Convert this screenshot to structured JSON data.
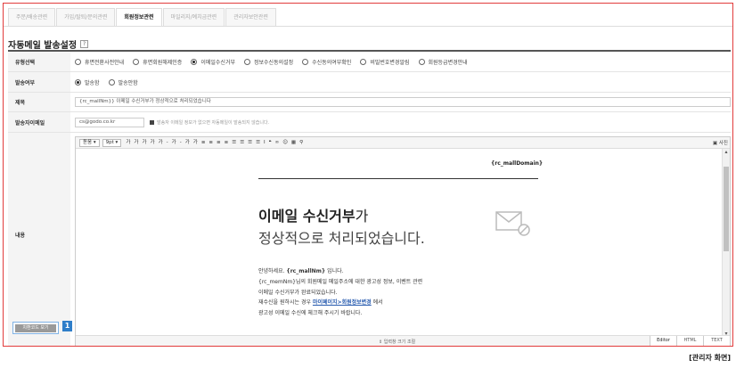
{
  "tabs": [
    "주문/배송관련",
    "가입/탈퇴/문의관련",
    "회원정보관련",
    "마일리지/예치금관련",
    "관리자보안관련"
  ],
  "active_tab": 2,
  "page_title": "자동메일 발송설정",
  "help_icon_text": "?",
  "fields": {
    "type": {
      "label": "유형선택",
      "options": [
        "휴면전환사전안내",
        "휴면회원해제인증",
        "이메일수신거부",
        "정보수신동의설정",
        "수신동의여부확인",
        "비밀번호변경알림",
        "회원등급변경안내"
      ],
      "selected": 2
    },
    "send": {
      "label": "발송여부",
      "options": [
        "발송함",
        "발송안함"
      ],
      "selected": 0
    },
    "subject": {
      "label": "제목",
      "value": "{rc_mallNm}} 이메일 수신거부가 정상적으로 처리되었습니다"
    },
    "sender": {
      "label": "발송자이메일",
      "value": "cs@godo.co.kr",
      "note": "발송자 이메일 정보가 없으면 자동메일이 발송되지 않습니다."
    },
    "content": {
      "label": "내용",
      "source_button": "치환코드 보기",
      "badge": "1"
    }
  },
  "editor": {
    "toolbar": {
      "font": "돋움",
      "size": "9pt",
      "buttons": [
        "가",
        "가",
        "가",
        "가",
        "가",
        "-",
        "가",
        "-",
        "가",
        "가",
        "≡",
        "≡",
        "≡",
        "≡",
        "☰",
        "☰",
        "☰",
        "☰",
        "I",
        "❝",
        "∞",
        "☺",
        "▦",
        "⚲"
      ],
      "right": "사진"
    },
    "mall_domain": "{rc_mallDomain}",
    "heading_bold": "이메일 수신거부",
    "heading_rest": "가",
    "heading_line2": "정상적으로 처리되었습니다.",
    "body": {
      "l1_pre": "안녕하세요. ",
      "l1_bold": "{rc_mallNm}",
      "l1_post": " 입니다.",
      "l2": "{rc_memNm}님의 회원메일 메일주소에 대한 광고성 정보, 이벤트 관련",
      "l3": "이메일 수신거부가 완료되었습니다.",
      "l4_pre": "재수신을 원하시는 경우 ",
      "l4_link": "마이페이지>회원정보변경",
      "l4_post": " 에서",
      "l5": "광고성 이메일 수신에 체크해 주시기 바랍니다."
    },
    "resize_label": "⇕ 입력창 크기 조절",
    "modes": [
      "Editor",
      "HTML",
      "TEXT"
    ],
    "active_mode": 0
  },
  "caption": "[관리자 화면]",
  "colors": {
    "frame": "#e23b3b",
    "badge": "#2f7ec9",
    "link": "#2a5db0"
  }
}
